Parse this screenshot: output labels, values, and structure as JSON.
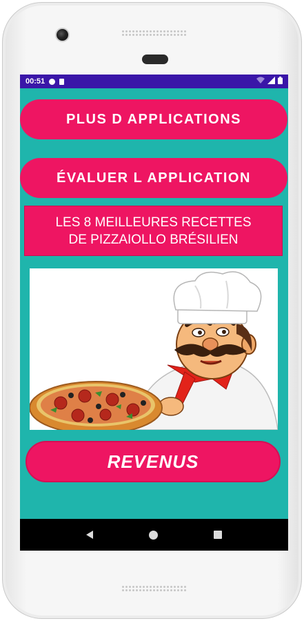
{
  "status_bar": {
    "time": "00:51"
  },
  "buttons": {
    "more_apps": "PLUS D APPLICATIONS",
    "rate_app": "ÉVALUER L APPLICATION",
    "revenus": "REVENUS"
  },
  "title": {
    "line1": "LES 8 MEILLEURES RECETTES",
    "line2": "DE PIZZAIOLLO BRÉSILIEN"
  },
  "colors": {
    "background": "#1fb5ac",
    "accent": "#ee1562",
    "status_bar": "#3a16a8"
  },
  "icons": {
    "nav": [
      "back-icon",
      "home-icon",
      "recents-icon"
    ]
  }
}
